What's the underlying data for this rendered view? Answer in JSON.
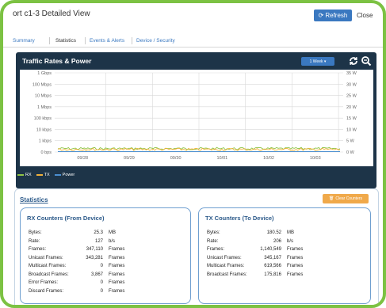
{
  "window": {
    "title": "ort c1-3 Detailed View",
    "refresh_label": "Refresh",
    "close_label": "Close"
  },
  "tabs": [
    {
      "label": "Summary"
    },
    {
      "label": "Statistics"
    },
    {
      "label": "Events & Alerts"
    },
    {
      "label": "Device / Security"
    }
  ],
  "traffic_panel": {
    "title": "Traffic Rates & Power",
    "range_label": "1 Week ▾",
    "icons": [
      "refresh-icon",
      "zoom-icon"
    ]
  },
  "chart_data": {
    "type": "line",
    "title": "Traffic Rates & Power",
    "x": [
      "09/28",
      "09/29",
      "09/30",
      "10/01",
      "10/02",
      "10/03"
    ],
    "y_left_ticks": [
      "1 Gbps",
      "100 Mbps",
      "10 Mbps",
      "1 Mbps",
      "100 kbps",
      "10 kbps",
      "1 kbps",
      "0 bps"
    ],
    "y_right_ticks": [
      "35 W",
      "30 W",
      "25 W",
      "20 W",
      "15 W",
      "10 W",
      "5 W",
      "0 W"
    ],
    "y_left_scale": "log",
    "grid": true,
    "legend_position": "bottom-left",
    "series": [
      {
        "name": "RX",
        "color": "#8fc446",
        "level": "near 1 kbps, noisy"
      },
      {
        "name": "TX",
        "color": "#f0b13a",
        "level": "near 1 kbps, noisy"
      },
      {
        "name": "Power",
        "color": "#4a8ed0",
        "level": "near 0 W"
      }
    ]
  },
  "legend": [
    {
      "label": "RX",
      "color": "#8fc446"
    },
    {
      "label": "TX",
      "color": "#f0b13a"
    },
    {
      "label": "Power",
      "color": "#4a8ed0"
    }
  ],
  "statistics": {
    "title": "Statistics",
    "clear_label": "Clear Counters",
    "rx": {
      "title": "RX Counters (From Device)",
      "rows": [
        {
          "label": "Bytes:",
          "value": "25.3",
          "unit": "MB"
        },
        {
          "label": "Rate:",
          "value": "127",
          "unit": "b/s"
        },
        {
          "label": "Frames:",
          "value": "347,110",
          "unit": "Frames"
        },
        {
          "label": "Unicast Frames:",
          "value": "343,281",
          "unit": "Frames"
        },
        {
          "label": "Multicast Frames:",
          "value": "0",
          "unit": "Frames"
        },
        {
          "label": "Broadcast Frames:",
          "value": "3,867",
          "unit": "Frames"
        },
        {
          "label": "Error Frames:",
          "value": "0",
          "unit": "Frames"
        },
        {
          "label": "Discard Frames:",
          "value": "0",
          "unit": "Frames"
        }
      ]
    },
    "tx": {
      "title": "TX Counters (To Device)",
      "rows": [
        {
          "label": "Bytes:",
          "value": "180.52",
          "unit": "MB"
        },
        {
          "label": "Rate:",
          "value": "206",
          "unit": "b/s"
        },
        {
          "label": "Frames:",
          "value": "1,140,549",
          "unit": "Frames"
        },
        {
          "label": "Unicast Frames:",
          "value": "345,167",
          "unit": "Frames"
        },
        {
          "label": "Multicast Frames:",
          "value": "619,566",
          "unit": "Frames"
        },
        {
          "label": "Broadcast Frames:",
          "value": "175,816",
          "unit": "Frames"
        }
      ]
    }
  },
  "colors": {
    "accent": "#3a78c0",
    "frame": "#7cc243",
    "panel": "#1d3448",
    "clear_button": "#f0a94a"
  }
}
